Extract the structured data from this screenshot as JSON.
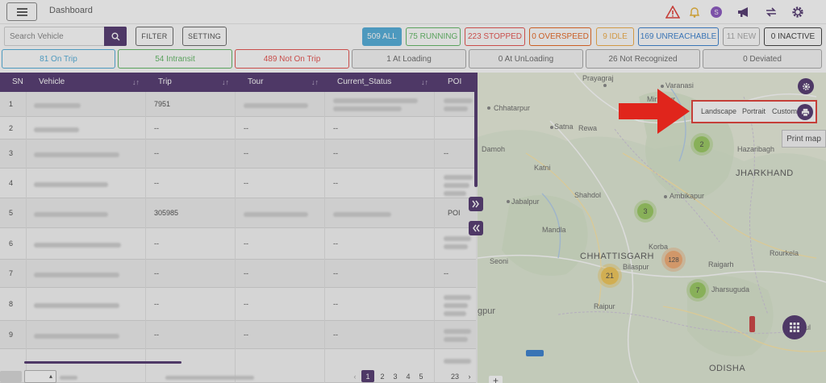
{
  "header": {
    "title": "Dashboard",
    "icons": [
      "menu-icon",
      "warning-icon",
      "bell-icon",
      "theme-icon",
      "megaphone-icon",
      "refresh-icon",
      "gear-icon"
    ]
  },
  "search": {
    "placeholder": "Search Vehicle"
  },
  "toolbar": {
    "filter_label": "FILTER",
    "setting_label": "SETTING"
  },
  "status_chips": [
    {
      "label": "509 ALL",
      "color": "#3aa3d6"
    },
    {
      "label": "75 RUNNING",
      "color": "#4caf50"
    },
    {
      "label": "223 STOPPED",
      "color": "#e53935"
    },
    {
      "label": "0 OVERSPEED",
      "color": "#e65100"
    },
    {
      "label": "9 IDLE",
      "color": "#f0a22e"
    },
    {
      "label": "169 UNREACHABLE",
      "color": "#1e6fc9"
    },
    {
      "label": "11 NEW",
      "color": "#9e9e9e"
    },
    {
      "label": "0 INACTIVE",
      "color": "#222222"
    }
  ],
  "trip_chips": [
    {
      "label": "81  On Trip",
      "color": "#3aa3d6"
    },
    {
      "label": "54  Intransit",
      "color": "#4caf50"
    },
    {
      "label": "489  Not On Trip",
      "color": "#e53935"
    },
    {
      "label": "1  At Loading",
      "color": "#9e9e9e"
    },
    {
      "label": "0  At UnLoading",
      "color": "#9e9e9e"
    },
    {
      "label": "26  Not Recognized",
      "color": "#9e9e9e"
    },
    {
      "label": "0  Deviated",
      "color": "#9e9e9e"
    }
  ],
  "table": {
    "columns": [
      "SN",
      "Vehicle",
      "Trip",
      "Tour",
      "Current_Status",
      "POI"
    ],
    "rows": [
      {
        "sn": "1",
        "trip": "7951",
        "tour": "",
        "status": "",
        "poi": ""
      },
      {
        "sn": "2",
        "trip": "--",
        "tour": "--",
        "status": "--",
        "poi": ""
      },
      {
        "sn": "3",
        "trip": "--",
        "tour": "--",
        "status": "--",
        "poi": "--"
      },
      {
        "sn": "4",
        "trip": "--",
        "tour": "--",
        "status": "--",
        "poi": ""
      },
      {
        "sn": "5",
        "trip": "305985",
        "tour": "",
        "status": "",
        "poi": "POI"
      },
      {
        "sn": "6",
        "trip": "--",
        "tour": "--",
        "status": "--",
        "poi": ""
      },
      {
        "sn": "7",
        "trip": "--",
        "tour": "--",
        "status": "--",
        "poi": "--"
      },
      {
        "sn": "8",
        "trip": "--",
        "tour": "--",
        "status": "--",
        "poi": ""
      },
      {
        "sn": "9",
        "trip": "--",
        "tour": "--",
        "status": "--",
        "poi": ""
      }
    ]
  },
  "pagination": {
    "pages": [
      "1",
      "2",
      "3",
      "4",
      "5"
    ],
    "last": "23",
    "active": 1
  },
  "map": {
    "cities": [
      {
        "name": "Prayagraj"
      },
      {
        "name": "Varanasi"
      },
      {
        "name": "Chhatarpur"
      },
      {
        "name": "Mirzapur"
      },
      {
        "name": "Satna"
      },
      {
        "name": "Rewa"
      },
      {
        "name": "Damoh"
      },
      {
        "name": "Katni"
      },
      {
        "name": "Shahdol"
      },
      {
        "name": "Jabalpur"
      },
      {
        "name": "Ambikapur"
      },
      {
        "name": "Mandla"
      },
      {
        "name": "Korba"
      },
      {
        "name": "Seoni"
      },
      {
        "name": "Bilaspur"
      },
      {
        "name": "Raigarh"
      },
      {
        "name": "Rourkela"
      },
      {
        "name": "Jharsuguda"
      },
      {
        "name": "Raipur"
      },
      {
        "name": "Hazaribagh"
      },
      {
        "name": "Angul"
      }
    ],
    "states": [
      "JHARKHAND",
      "CHHATTISGARH",
      "ODISHA"
    ],
    "clusters": [
      {
        "label": "2",
        "color": "#8bc34a"
      },
      {
        "label": "3",
        "color": "#8bc34a"
      },
      {
        "label": "128",
        "color": "#f0a060"
      },
      {
        "label": "21",
        "color": "#f0c040"
      },
      {
        "label": "7",
        "color": "#8bc34a"
      }
    ],
    "print_options": {
      "landscape": "Landscape",
      "portrait": "Portrait",
      "custom": "Custom"
    },
    "tooltip": "Print map",
    "gpur_label": "gpur"
  }
}
